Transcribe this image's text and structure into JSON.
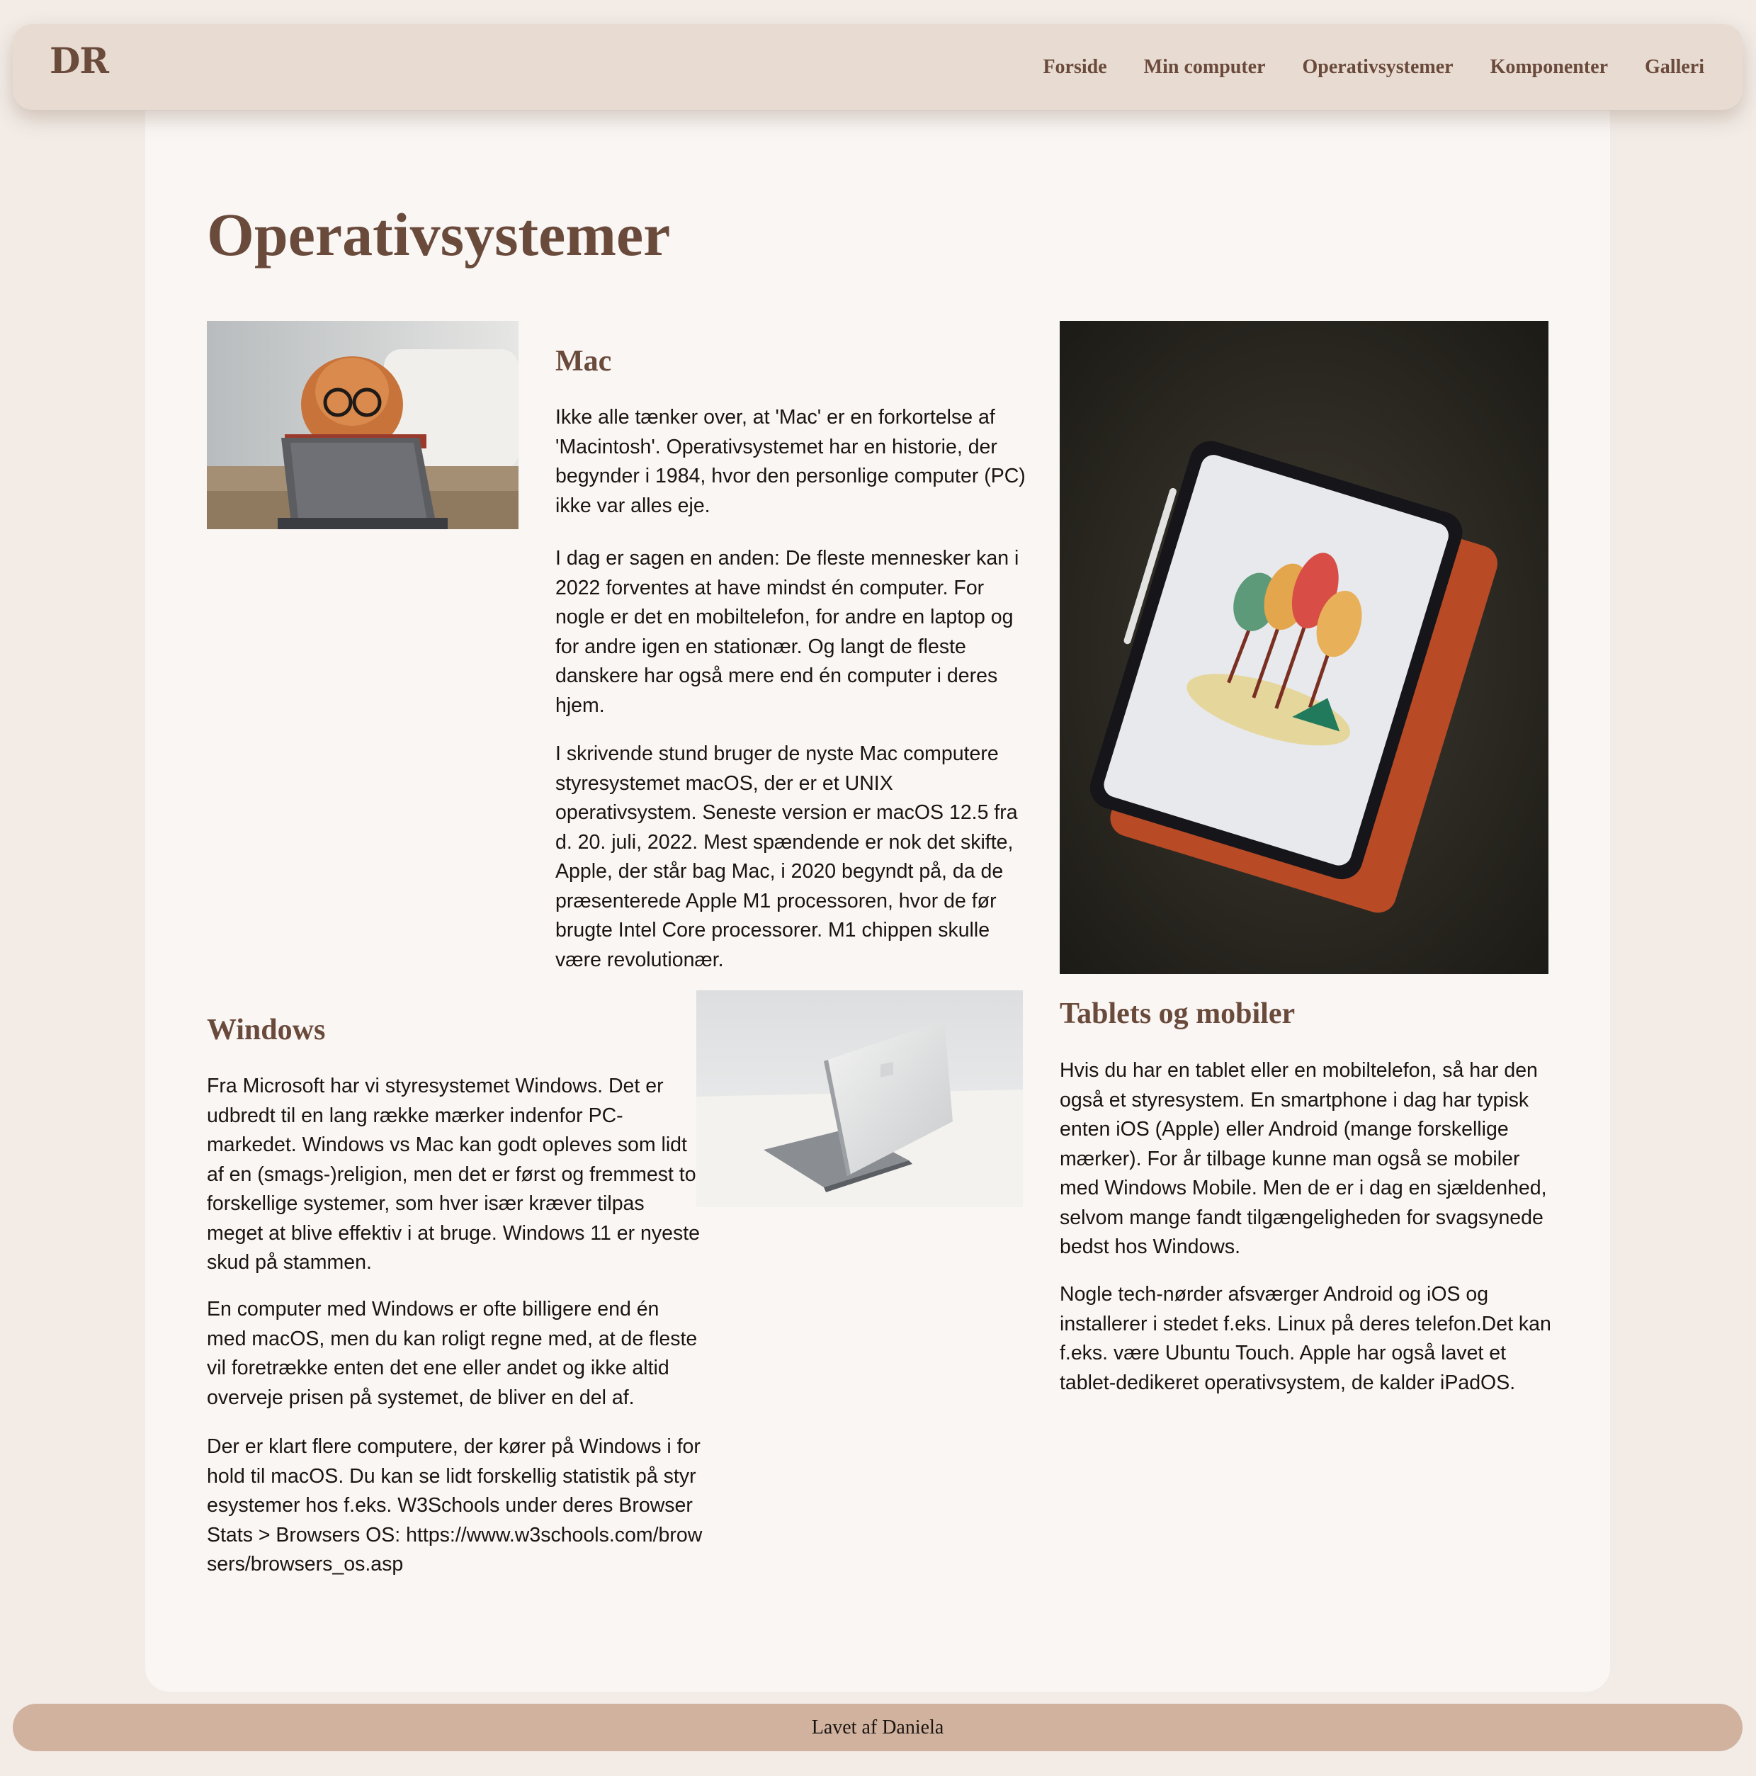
{
  "header": {
    "logo": "DR",
    "nav": [
      "Forside",
      "Min computer",
      "Operativsystemer",
      "Komponenter",
      "Galleri"
    ]
  },
  "main": {
    "title": "Operativsystemer",
    "mac": {
      "title": "Mac",
      "paragraphs": [
        "Ikke alle tænker over, at 'Mac' er en forkortelse af 'Macintosh'. Operativsystemet har en historie, der begynder i 1984, hvor den personlige computer (PC) ikke var alles eje.",
        "I dag er sagen en anden: De fleste mennesker kan i 2022 forventes at have mindst én computer. For nogle er det en mobiltelefon, for andre en laptop og for andre igen en stationær. Og langt de fleste danskere har også mere end én computer i deres hjem.",
        "I skrivende stund bruger de nyste Mac computere styresystemet macOS, der er et UNIX operativsystem. Seneste version er macOS 12.5 fra d. 20. juli, 2022. Mest spændende er nok det skifte, Apple, der står bag Mac, i 2020 begyndt på, da de præsenterede Apple M1 processoren, hvor de før brugte Intel Core processorer. M1 chippen skulle være revolutionær."
      ]
    },
    "windows": {
      "title": "Windows",
      "paragraphs": [
        "Fra Microsoft har vi styresystemet Windows. Det er udbredt til en lang række mærker indenfor PC-markedet. Windows vs Mac kan godt opleves som lidt af en (smags-)religion, men det er først og fremmest to forskellige systemer, som hver især kræver tilpas meget at blive effektiv i at bruge. Windows 11 er nyeste skud på stammen.",
        "En computer med Windows er ofte billigere end én med macOS, men du kan roligt regne med, at de fleste vil foretrække enten det ene eller andet og ikke altid overveje prisen på systemet, de bliver en del af.",
        "Der er klart flere computere, der kører på Windows i forhold til macOS. Du kan se lidt forskellig statistik på styresystemer hos f.eks. W3Schools under deres Browser Stats > Browsers OS: https://www.w3schools.com/browsers/browsers_os.asp"
      ]
    },
    "tablets": {
      "title": "Tablets og mobiler",
      "paragraphs": [
        "Hvis du har en tablet eller en mobiltelefon, så har den også et styresystem. En smartphone i dag har typisk enten iOS (Apple) eller Android (mange forskellige mærker). For år tilbage kunne man også se mobiler med Windows Mobile. Men de er i dag en sjældenhed, selvom mange fandt tilgængeligheden for svagsynede bedst hos Windows.",
        "Nogle tech-nørder afsværger Android og iOS og installerer i stedet f.eks. Linux på deres telefon.Det kan f.eks. være Ubuntu Touch. Apple har også lavet et tablet-dedikeret operativsystem, de kalder iPadOS."
      ]
    }
  },
  "footer": {
    "text": "Lavet af Daniela"
  },
  "colors": {
    "page_bg": "#f2ebe6",
    "nav_bg": "#e8dbd1",
    "card_bg": "#f9f6f4",
    "heading": "#6a4a3b",
    "footer_bg": "#d0b29f"
  },
  "icons": {
    "dog_photo": "dog-with-glasses-laptop-image",
    "laptop_photo": "silver-laptop-image",
    "tablet_photo": "tablet-on-orange-case-image"
  }
}
